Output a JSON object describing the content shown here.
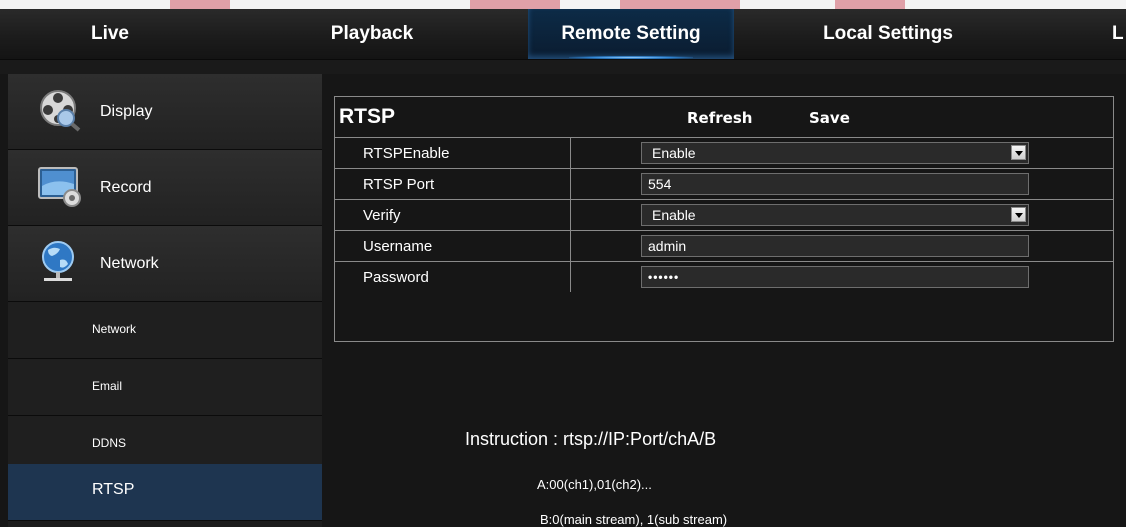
{
  "nav": {
    "tabs": [
      {
        "label": "Live"
      },
      {
        "label": "Playback"
      },
      {
        "label": "Remote Setting",
        "active": true
      },
      {
        "label": "Local Settings"
      },
      {
        "label": "L"
      }
    ]
  },
  "sidebar": {
    "items": [
      {
        "label": "Display",
        "icon": "film-reel-icon"
      },
      {
        "label": "Record",
        "icon": "monitor-record-icon"
      },
      {
        "label": "Network",
        "icon": "globe-network-icon"
      },
      {
        "label": "Network"
      },
      {
        "label": "Email"
      },
      {
        "label": "DDNS"
      },
      {
        "label": "RTSP",
        "active": true
      }
    ]
  },
  "panel": {
    "title": "RTSP",
    "refresh_label": "Refresh",
    "save_label": "Save",
    "fields": [
      {
        "label": "RTSPEnable",
        "type": "select",
        "value": "Enable"
      },
      {
        "label": "RTSP Port",
        "type": "text",
        "value": "554"
      },
      {
        "label": "Verify",
        "type": "select",
        "value": "Enable"
      },
      {
        "label": "Username",
        "type": "text",
        "value": "admin"
      },
      {
        "label": "Password",
        "type": "password",
        "value": "••••••"
      }
    ]
  },
  "instructions": {
    "main": "Instruction : rtsp://IP:Port/chA/B",
    "line_a": "A:00(ch1),01(ch2)...",
    "line_b": "B:0(main stream), 1(sub stream)"
  },
  "colors": {
    "background": "#161616",
    "active_tab": "#0d2b47",
    "active_sidebar": "#1e3550",
    "border": "#8a8a8a"
  }
}
